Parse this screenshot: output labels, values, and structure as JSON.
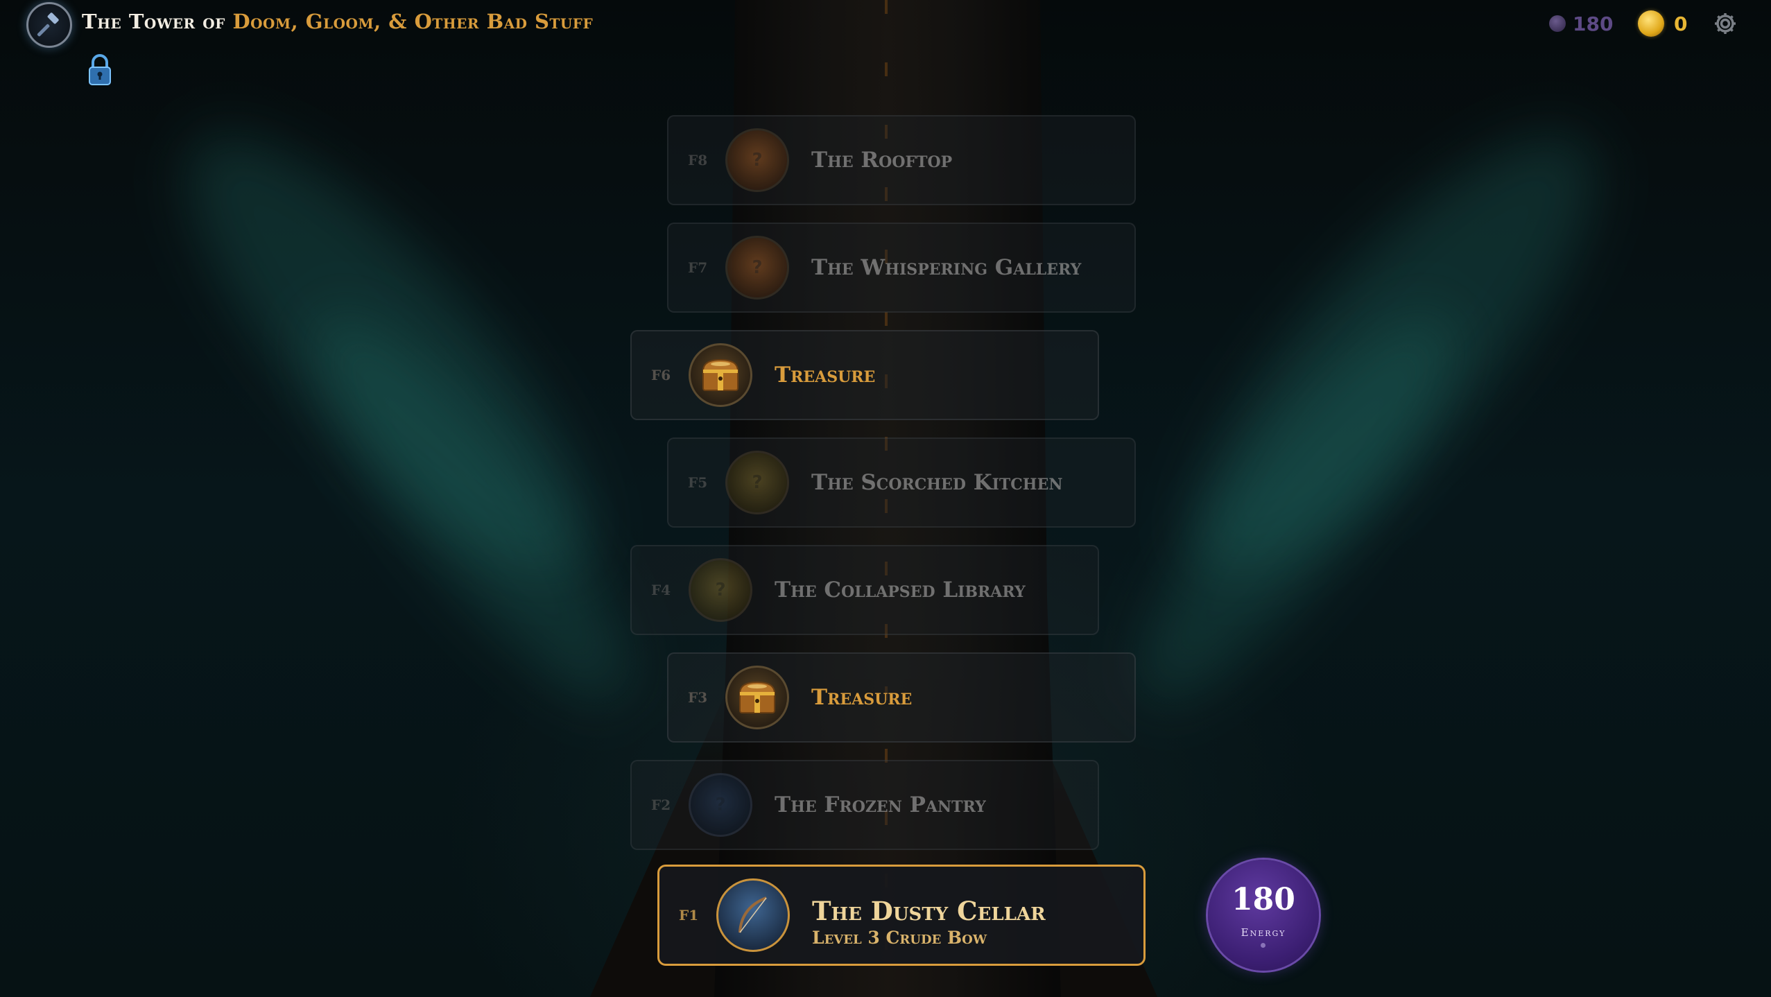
{
  "header": {
    "title_prefix": "The Tower of ",
    "title_highlight": "Doom, Gloom, & Other Bad Stuff",
    "logo_icon": "hammer-icon",
    "lock_icon": "lock-icon",
    "settings_icon": "gear-icon"
  },
  "resources": {
    "energy": "180",
    "gold": "0"
  },
  "floors": [
    {
      "id": "F8",
      "name": "The Rooftop",
      "icon": "question-mark",
      "type": "room"
    },
    {
      "id": "F7",
      "name": "The Whispering Gallery",
      "icon": "question-mark",
      "type": "room"
    },
    {
      "id": "F6",
      "name": "Treasure",
      "icon": "treasure-chest-icon",
      "type": "treasure"
    },
    {
      "id": "F5",
      "name": "The Scorched Kitchen",
      "icon": "question-mark",
      "type": "room"
    },
    {
      "id": "F4",
      "name": "The Collapsed Library",
      "icon": "question-mark",
      "type": "room"
    },
    {
      "id": "F3",
      "name": "Treasure",
      "icon": "treasure-chest-icon",
      "type": "treasure"
    },
    {
      "id": "F2",
      "name": "The Frozen Pantry",
      "icon": "question-mark",
      "type": "room"
    },
    {
      "id": "F1",
      "name": "The Dusty Cellar",
      "subtitle": "Level 3 Crude Bow",
      "icon": "bow-icon",
      "type": "current"
    }
  ],
  "unknown_mark": "?",
  "energy_badge": {
    "value": "180",
    "label": "Energy"
  },
  "colors": {
    "accent_gold": "#d99c3c",
    "energy_purple": "#3c1f73"
  }
}
